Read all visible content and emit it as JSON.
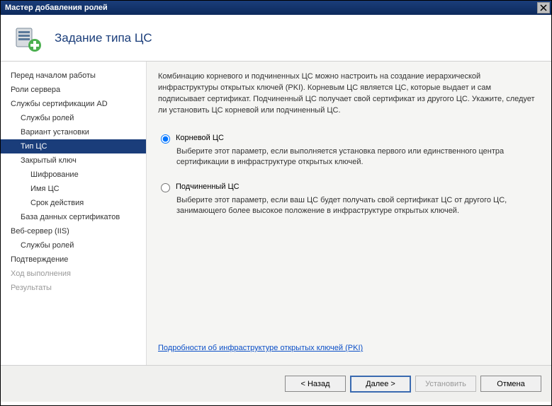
{
  "window": {
    "title": "Мастер добавления ролей"
  },
  "header": {
    "title": "Задание типа ЦС"
  },
  "sidebar": {
    "items": [
      {
        "label": "Перед началом работы",
        "lvl": 0
      },
      {
        "label": "Роли сервера",
        "lvl": 0
      },
      {
        "label": "Службы сертификации AD",
        "lvl": 0
      },
      {
        "label": "Службы ролей",
        "lvl": 1
      },
      {
        "label": "Вариант установки",
        "lvl": 1
      },
      {
        "label": "Тип ЦС",
        "lvl": 1,
        "selected": true
      },
      {
        "label": "Закрытый ключ",
        "lvl": 1
      },
      {
        "label": "Шифрование",
        "lvl": 2
      },
      {
        "label": "Имя ЦС",
        "lvl": 2
      },
      {
        "label": "Срок действия",
        "lvl": 2
      },
      {
        "label": "База данных сертификатов",
        "lvl": 1
      },
      {
        "label": "Веб-сервер (IIS)",
        "lvl": 0
      },
      {
        "label": "Службы ролей",
        "lvl": 1
      },
      {
        "label": "Подтверждение",
        "lvl": 0
      },
      {
        "label": "Ход выполнения",
        "lvl": 0,
        "disabled": true
      },
      {
        "label": "Результаты",
        "lvl": 0,
        "disabled": true
      }
    ]
  },
  "content": {
    "intro": "Комбинацию корневого и подчиненных ЦС можно настроить на создание иерархической инфраструктуры открытых ключей (PKI). Корневым ЦС является ЦС, которые выдает и сам подписывает сертификат. Подчиненный ЦС получает свой сертификат из другого ЦС. Укажите, следует ли установить ЦС корневой или подчиненный ЦС.",
    "options": [
      {
        "label": "Корневой ЦС",
        "desc": "Выберите этот параметр, если выполняется установка первого или единственного центра сертификации в инфраструктуре открытых ключей.",
        "checked": true
      },
      {
        "label": "Подчиненный ЦС",
        "desc": "Выберите этот параметр, если ваш ЦС будет получать свой сертификат ЦС от другого ЦС, занимающего более высокое положение в инфраструктуре открытых ключей.",
        "checked": false
      }
    ],
    "link": "Подробности об инфраструктуре открытых ключей (PKI)"
  },
  "footer": {
    "back": "< Назад",
    "next": "Далее >",
    "install": "Установить",
    "cancel": "Отмена"
  }
}
